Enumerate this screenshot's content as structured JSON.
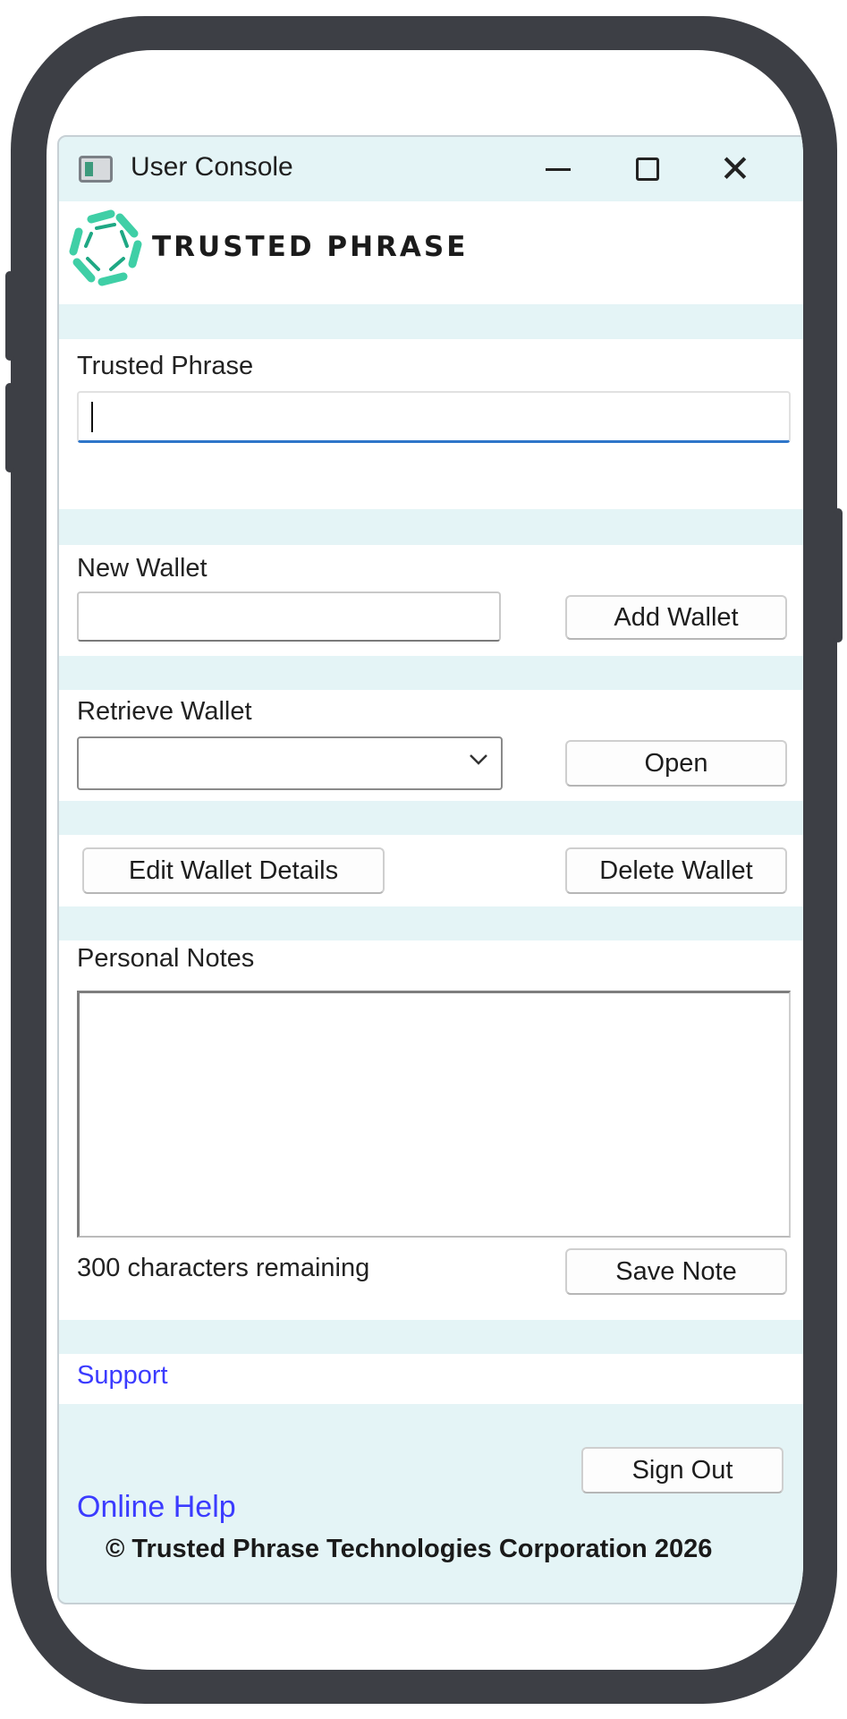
{
  "window": {
    "title": "User Console"
  },
  "brand": {
    "logo_text": "TRUSTED PHRASE"
  },
  "trusted_phrase": {
    "label": "Trusted Phrase",
    "value": ""
  },
  "new_wallet": {
    "label": "New Wallet",
    "value": "",
    "button": "Add Wallet"
  },
  "retrieve_wallet": {
    "label": "Retrieve Wallet",
    "selected": "",
    "button": "Open"
  },
  "wallet_actions": {
    "edit": "Edit Wallet Details",
    "delete": "Delete Wallet"
  },
  "notes": {
    "label": "Personal Notes",
    "value": "",
    "remaining": "300 characters remaining",
    "save": "Save Note"
  },
  "footer": {
    "support": "Support",
    "sign_out": "Sign Out",
    "online_help": "Online Help",
    "copyright": "© Trusted Phrase Technologies Corporation 2026"
  },
  "colors": {
    "panel_bg": "#e4f4f6",
    "brand_accent": "#3fcfa6",
    "link": "#3b3bff",
    "focus": "#2f76c9"
  }
}
